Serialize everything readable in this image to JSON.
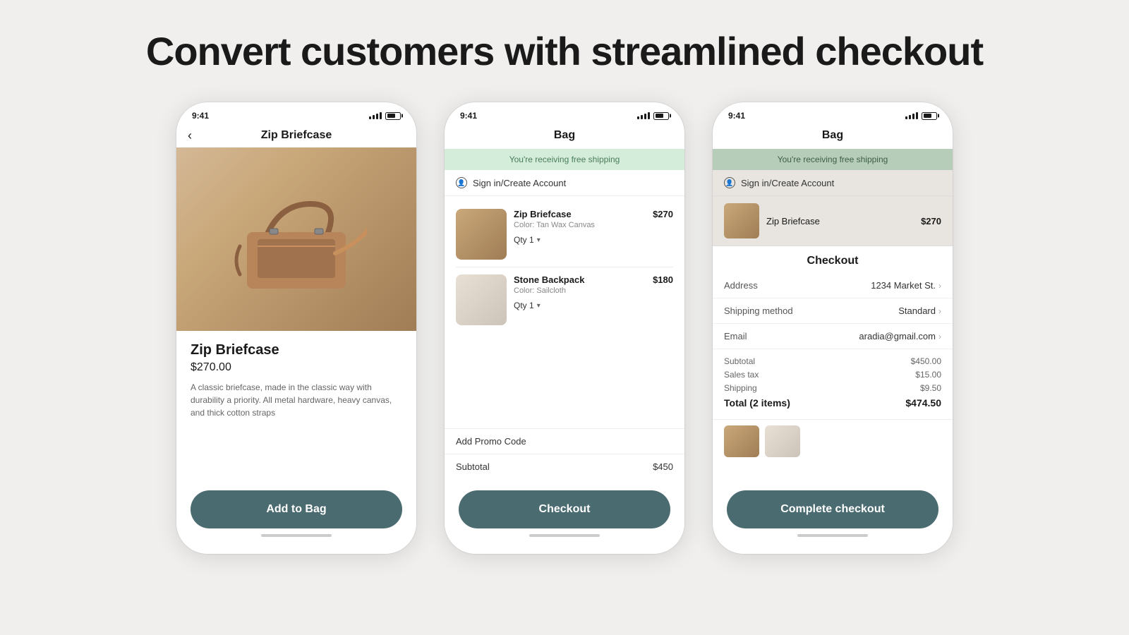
{
  "headline": "Convert customers with streamlined checkout",
  "phone1": {
    "time": "9:41",
    "nav_back": "‹",
    "title": "Zip Briefcase",
    "product_name": "Zip Briefcase",
    "price": "$270.00",
    "description": "A classic briefcase, made in the classic way with durability a priority. All metal hardware, heavy canvas, and thick cotton straps",
    "cta": "Add to Bag"
  },
  "phone2": {
    "time": "9:41",
    "title": "Bag",
    "free_shipping": "You're receiving free shipping",
    "sign_in": "Sign in/Create Account",
    "items": [
      {
        "name": "Zip Briefcase",
        "color": "Color: Tan Wax Canvas",
        "qty": "Qty 1",
        "price": "$270"
      },
      {
        "name": "Stone Backpack",
        "color": "Color: Sailcloth",
        "qty": "Qty 1",
        "price": "$180"
      }
    ],
    "promo": "Add Promo Code",
    "subtotal_label": "Subtotal",
    "subtotal_value": "$450",
    "cta": "Checkout"
  },
  "phone3": {
    "time": "9:41",
    "bag_title": "Bag",
    "free_shipping": "You're receiving free shipping",
    "sign_in": "Sign in/Create Account",
    "preview_item": "Zip Briefcase",
    "preview_price": "$270",
    "checkout_title": "Checkout",
    "address_label": "Address",
    "address_value": "1234 Market St.",
    "shipping_label": "Shipping method",
    "shipping_value": "Standard",
    "email_label": "Email",
    "email_value": "aradia@gmail.com",
    "subtotal_label": "Subtotal",
    "subtotal_value": "$450.00",
    "tax_label": "Sales tax",
    "tax_value": "$15.00",
    "shipping_cost_label": "Shipping",
    "shipping_cost_value": "$9.50",
    "total_label": "Total (2 items)",
    "total_value": "$474.50",
    "cta": "Complete checkout"
  }
}
